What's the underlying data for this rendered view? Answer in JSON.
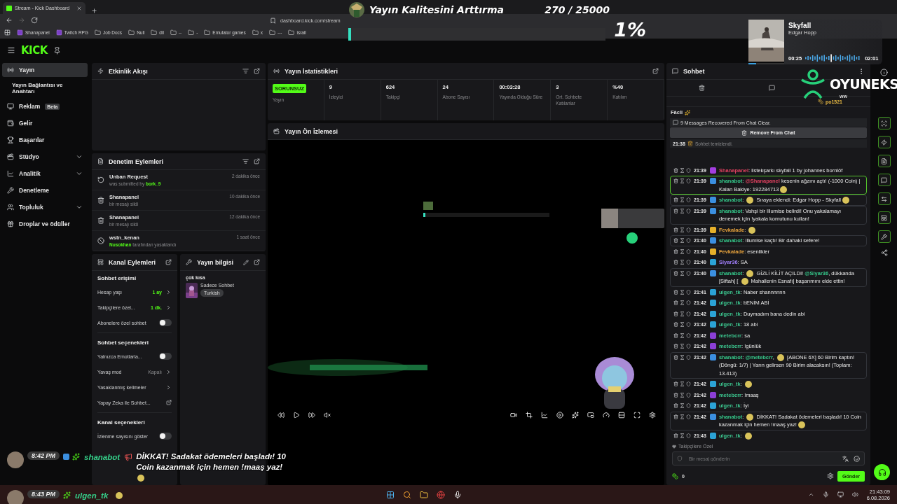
{
  "browser": {
    "tab_title": "Stream - Kick Dashboard",
    "url": "dashboard.kick.com/stream",
    "bookmarks": [
      {
        "label": "Shanapanel",
        "kind": "site"
      },
      {
        "label": "Twitch RPG",
        "kind": "site"
      },
      {
        "label": "Job Docs",
        "kind": "folder"
      },
      {
        "label": "Null",
        "kind": "folder"
      },
      {
        "label": "dil",
        "kind": "folder"
      },
      {
        "label": "--",
        "kind": "folder"
      },
      {
        "label": "-",
        "kind": "folder"
      },
      {
        "label": "Emulator games",
        "kind": "folder"
      },
      {
        "label": "x",
        "kind": "folder"
      },
      {
        "label": "---",
        "kind": "folder"
      },
      {
        "label": "israil",
        "kind": "folder"
      }
    ]
  },
  "app": {
    "logo": "KICK"
  },
  "sidebar": {
    "items": [
      {
        "label": "Yayın",
        "kind": "main",
        "selected": true,
        "expandable": false
      },
      {
        "label": "Yayın Bağlantısı ve Anahtarı",
        "kind": "sub",
        "selected": false,
        "expandable": false
      },
      {
        "label": "Reklam",
        "kind": "main",
        "badge": "Beta",
        "selected": false,
        "expandable": false
      },
      {
        "label": "Gelir",
        "kind": "main",
        "selected": false,
        "expandable": false
      },
      {
        "label": "Başarılar",
        "kind": "main",
        "selected": false,
        "expandable": false
      },
      {
        "label": "Stüdyo",
        "kind": "main",
        "selected": false,
        "expandable": true
      },
      {
        "label": "Analitik",
        "kind": "main",
        "selected": false,
        "expandable": true
      },
      {
        "label": "Denetleme",
        "kind": "main",
        "selected": false,
        "expandable": false
      },
      {
        "label": "Topluluk",
        "kind": "main",
        "selected": false,
        "expandable": true
      },
      {
        "label": "Droplar ve ödüller",
        "kind": "main",
        "selected": false,
        "expandable": false
      }
    ]
  },
  "activity_feed": {
    "title": "Etkinlik Akışı"
  },
  "moderation": {
    "title": "Denetim Eylemleri",
    "items": [
      {
        "kind": "unban",
        "title": "Unban Request",
        "detail": [
          {
            "kind": "text",
            "text": "was submitted by "
          },
          {
            "kind": "user",
            "text": "bork_9"
          }
        ],
        "time": "2 dakika önce"
      },
      {
        "kind": "delete",
        "title": "Shanapanel",
        "detail": [
          {
            "kind": "text",
            "text": "bir mesajı sildi"
          }
        ],
        "time": "10 dakika önce"
      },
      {
        "kind": "delete",
        "title": "Shanapanel",
        "detail": [
          {
            "kind": "text",
            "text": "bir mesajı sildi"
          }
        ],
        "time": "12 dakika önce"
      },
      {
        "kind": "ban",
        "title": "wstn_kenan",
        "detail": [
          {
            "kind": "user",
            "text": "Nusokhan"
          },
          {
            "kind": "text",
            "text": " tarafından yasaklandı"
          }
        ],
        "time": "1 saat önce"
      }
    ]
  },
  "channel_actions": {
    "title": "Kanal Eylemleri",
    "sections": [
      {
        "title": "Sohbet erişimi",
        "rows": [
          {
            "kind": "value",
            "label": "Hesap yaşı",
            "value": "1 ay",
            "active": true
          },
          {
            "kind": "value",
            "label": "Takipçilere özel...",
            "value": "1 dk.",
            "active": true
          },
          {
            "kind": "toggle",
            "label": "Abonelere özel sohbet",
            "on": false
          }
        ]
      },
      {
        "title": "Sohbet seçenekleri",
        "rows": [
          {
            "kind": "toggle",
            "label": "Yalnızca Emotlarla...",
            "on": false
          },
          {
            "kind": "value",
            "label": "Yavaş mod",
            "value": "Kapalı",
            "active": false
          },
          {
            "kind": "link",
            "label": "Yasaklanmış kelimeler"
          },
          {
            "kind": "external",
            "label": "Yapay Zeka ile Sohbet..."
          }
        ]
      },
      {
        "title": "Kanal seçenekleri",
        "rows": [
          {
            "kind": "toggle",
            "label": "İzlenme sayısını göster",
            "on": false
          }
        ]
      }
    ]
  },
  "stream_info": {
    "title": "Yayın bilgisi",
    "stream_title": "çok kısa",
    "category": "Sadece Sohbet",
    "tags": [
      "Turkish"
    ]
  },
  "stats": {
    "title": "Yayın İstatistikleri",
    "cells": [
      {
        "kind": "badge",
        "value": "SORUNSUZ",
        "label": "Yayın"
      },
      {
        "kind": "number",
        "value": "9",
        "label": "İzleyici"
      },
      {
        "kind": "number",
        "value": "624",
        "label": "Takipçi"
      },
      {
        "kind": "number",
        "value": "24",
        "label": "Abone Sayısı"
      },
      {
        "kind": "number",
        "value": "00:03:28",
        "label": "Yayında Olduğu Süre"
      },
      {
        "kind": "number",
        "value": "3",
        "label": "Ort. Sohbete Katılanlar"
      },
      {
        "kind": "number",
        "value": "%40",
        "label": "Katılım"
      }
    ]
  },
  "preview": {
    "title": "Yayın Ön İzlemesi"
  },
  "chat": {
    "title": "Sohbet",
    "pinned_user": "po1521",
    "greeting": "Fâcli",
    "recovered": "9 Messages Recovered From Chat Clear.",
    "remove_button": "Remove From Chat",
    "cleared": {
      "time": "21:38",
      "text": "Sohbet temizlendi."
    },
    "messages": [
      {
        "kind": "plain",
        "time": "21:39",
        "badge": {
          "kind": "mic"
        },
        "user": "Shanapanel",
        "color": "#e0405f",
        "parts": [
          {
            "kind": "text",
            "text": ": listekşarkı skyfall 1 by johannes bornlöf"
          }
        ]
      },
      {
        "kind": "highlight",
        "time": "21:39",
        "badge": {
          "kind": "bot"
        },
        "user": "shanabot",
        "color": "#35c98b",
        "parts": [
          {
            "kind": "text",
            "text": ": "
          },
          {
            "kind": "mention",
            "text": "@Shanapanel",
            "color": "#e0405f"
          },
          {
            "kind": "text",
            "text": " kesenin ağzını açtı! (-1000 Coin) | Kalan Bakiye: 192284713"
          },
          {
            "kind": "emote"
          }
        ]
      },
      {
        "kind": "boxed",
        "time": "21:39",
        "badge": {
          "kind": "bot"
        },
        "user": "shanabot",
        "color": "#35c98b",
        "parts": [
          {
            "kind": "text",
            "text": ": "
          },
          {
            "kind": "emote"
          },
          {
            "kind": "text",
            "text": " Sıraya eklendi: Edgar Hopp - Skyfall"
          },
          {
            "kind": "emote"
          }
        ]
      },
      {
        "kind": "boxed",
        "time": "21:39",
        "badge": {
          "kind": "bot"
        },
        "user": "shanabot",
        "color": "#35c98b",
        "parts": [
          {
            "kind": "text",
            "text": ": Vahşi bir Illumise belirdi! Onu yakalamayı denemek için !yakala komutunu kullan!"
          }
        ]
      },
      {
        "kind": "plain",
        "time": "21:39",
        "badge": {
          "kind": "coin"
        },
        "user": "Fevkalade",
        "color": "#e8a33d",
        "parts": [
          {
            "kind": "text",
            "text": ": "
          },
          {
            "kind": "emote"
          }
        ]
      },
      {
        "kind": "boxed",
        "time": "21:40",
        "badge": {
          "kind": "bot"
        },
        "user": "shanabot",
        "color": "#35c98b",
        "parts": [
          {
            "kind": "text",
            "text": ": Illumise kaçtı! Bir dahaki sefere!"
          }
        ]
      },
      {
        "kind": "plain",
        "time": "21:40",
        "badge": {
          "kind": "coin"
        },
        "user": "Fevkalade",
        "color": "#e8a33d",
        "parts": [
          {
            "kind": "text",
            "text": ": esenlikler"
          }
        ]
      },
      {
        "kind": "plain",
        "time": "21:40",
        "badge": {
          "kind": "sub"
        },
        "user": "Slyar36",
        "color": "#9d7cf5",
        "parts": [
          {
            "kind": "text",
            "text": ": SA"
          }
        ]
      },
      {
        "kind": "boxed",
        "time": "21:40",
        "badge": {
          "kind": "bot"
        },
        "user": "shanabot",
        "color": "#35c98b",
        "parts": [
          {
            "kind": "text",
            "text": ": "
          },
          {
            "kind": "emote"
          },
          {
            "kind": "text",
            "text": " GİZLİ KİLİT AÇILDI! "
          },
          {
            "kind": "mention",
            "text": "@Slyar36",
            "color": "#35c98b"
          },
          {
            "kind": "text",
            "text": ", dükkanda [Siftah] [ "
          },
          {
            "kind": "emote"
          },
          {
            "kind": "text",
            "text": " Mahallenin Esnafı] başarımını elde ettin!"
          }
        ]
      },
      {
        "kind": "plain",
        "time": "21:41",
        "badge": {
          "kind": "sub"
        },
        "user": "ulgen_tk",
        "color": "#3cc68f",
        "parts": [
          {
            "kind": "text",
            "text": ": Naber shannnnnn"
          }
        ]
      },
      {
        "kind": "plain",
        "time": "21:42",
        "badge": {
          "kind": "sub"
        },
        "user": "ulgen_tk",
        "color": "#3cc68f",
        "parts": [
          {
            "kind": "text",
            "text": ": bENİM ABİ"
          }
        ]
      },
      {
        "kind": "plain",
        "time": "21:42",
        "badge": {
          "kind": "sub"
        },
        "user": "ulgen_tk",
        "color": "#3cc68f",
        "parts": [
          {
            "kind": "text",
            "text": ": Duymadım bana dedin abi"
          }
        ]
      },
      {
        "kind": "plain",
        "time": "21:42",
        "badge": {
          "kind": "sub"
        },
        "user": "ulgen_tk",
        "color": "#3cc68f",
        "parts": [
          {
            "kind": "text",
            "text": ": 18 abi"
          }
        ]
      },
      {
        "kind": "plain",
        "time": "21:42",
        "badge": {
          "kind": "gem"
        },
        "user": "metebcrr",
        "color": "#3cc68f",
        "parts": [
          {
            "kind": "text",
            "text": ": sa"
          }
        ]
      },
      {
        "kind": "plain",
        "time": "21:42",
        "badge": {
          "kind": "gem"
        },
        "user": "metebcrr",
        "color": "#3cc68f",
        "parts": [
          {
            "kind": "text",
            "text": ": !günlük"
          }
        ]
      },
      {
        "kind": "boxed",
        "time": "21:42",
        "badge": {
          "kind": "bot"
        },
        "user": "shanabot",
        "color": "#35c98b",
        "parts": [
          {
            "kind": "text",
            "text": ": "
          },
          {
            "kind": "mention",
            "text": "@metebcrr",
            "color": "#35c98b"
          },
          {
            "kind": "text",
            "text": ", "
          },
          {
            "kind": "emote"
          },
          {
            "kind": "text",
            "text": " [ABONE 6X] 60 Birim kaptın! (Döngü: 1/7) | Yarın gelirsen 90 Birim alacaksın! (Toplam: 13.413)"
          }
        ]
      },
      {
        "kind": "plain",
        "time": "21:42",
        "badge": {
          "kind": "sub"
        },
        "user": "ulgen_tk",
        "color": "#3cc68f",
        "parts": [
          {
            "kind": "text",
            "text": ": "
          },
          {
            "kind": "emote"
          }
        ]
      },
      {
        "kind": "plain",
        "time": "21:42",
        "badge": {
          "kind": "gem"
        },
        "user": "metebcrr",
        "color": "#3cc68f",
        "parts": [
          {
            "kind": "text",
            "text": ": !maaş"
          }
        ]
      },
      {
        "kind": "plain",
        "time": "21:42",
        "badge": {
          "kind": "sub"
        },
        "user": "ulgen_tk",
        "color": "#3cc68f",
        "parts": [
          {
            "kind": "text",
            "text": ": İyi"
          }
        ]
      },
      {
        "kind": "boxed",
        "time": "21:42",
        "badge": {
          "kind": "bot"
        },
        "user": "shanabot",
        "color": "#35c98b",
        "parts": [
          {
            "kind": "text",
            "text": ": "
          },
          {
            "kind": "emote"
          },
          {
            "kind": "text",
            "text": " DİKKAT! Sadakat ödemeleri başladı! 10 Coin kazanmak için hemen !maaş yaz!"
          },
          {
            "kind": "emote"
          }
        ]
      },
      {
        "kind": "plain",
        "time": "21:43",
        "badge": {
          "kind": "sub"
        },
        "user": "ulgen_tk",
        "color": "#3cc68f",
        "parts": [
          {
            "kind": "text",
            "text": ": "
          },
          {
            "kind": "emote"
          }
        ]
      }
    ],
    "followers_only": "Takipçilere Özel",
    "placeholder": "Bir mesaj gönderin",
    "points": "0",
    "send_button": "Gönder"
  },
  "overlays": {
    "goal": {
      "title": "Yayın Kalitesini Arttırma",
      "count": "270 / 25000",
      "percent": "1%",
      "level": 0.01
    },
    "music": {
      "title": "Skyfall",
      "artist": "Edgar Hopp",
      "elapsed": "00:25",
      "total": "02:01",
      "level": 0.21
    },
    "brand": {
      "name": "OYUNEKS",
      "sub": "ww"
    },
    "feed": [
      {
        "time": "8:42 PM",
        "user": "shanabot",
        "color": "#35d08a",
        "badges": true,
        "text": "DİKKAT! Sadakat ödemeleri başladı! 10 Coin kazanmak için hemen !maaş yaz!",
        "lead_emote": true,
        "trail_emote": true
      },
      {
        "time": "8:43 PM",
        "user": "ulgen_tk",
        "color": "#35d08a",
        "badges": false,
        "lead_emote": false,
        "trail_emote": true
      }
    ]
  },
  "taskbar": {
    "time": "21:43:09",
    "date": "6.08.2026"
  }
}
